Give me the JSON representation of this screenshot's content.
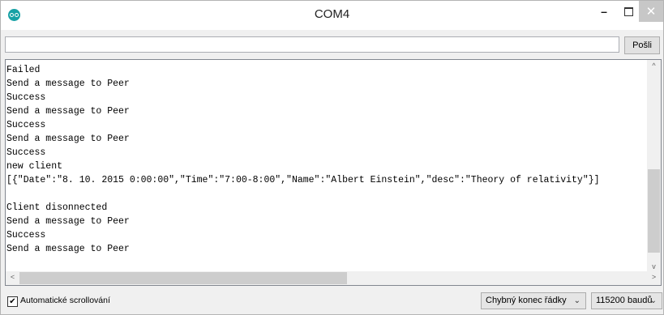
{
  "window": {
    "title": "COM4",
    "minimize_glyph": "–",
    "close_glyph": "✕"
  },
  "send_bar": {
    "input_value": "",
    "send_label": "Pošli"
  },
  "output": {
    "lines": [
      "Failed",
      "Send a message to Peer",
      "Success",
      "Send a message to Peer",
      "Success",
      "Send a message to Peer",
      "Success",
      "new client",
      "[{\"Date\":\"8. 10. 2015 0:00:00\",\"Time\":\"7:00-8:00\",\"Name\":\"Albert Einstein\",\"desc\":\"Theory of relativity\"}]",
      "",
      "Client disonnected",
      "Send a message to Peer",
      "Success",
      "Send a message to Peer"
    ]
  },
  "footer": {
    "autoscroll_checked": true,
    "autoscroll_label": "Automatické scrollování",
    "line_ending": "Chybný konec řádky",
    "baud_rate": "115200 baudů"
  },
  "icons": [
    "arduino-logo-icon",
    "minimize-icon",
    "maximize-icon",
    "close-icon",
    "checkbox-check-icon",
    "chevron-down-icon"
  ]
}
